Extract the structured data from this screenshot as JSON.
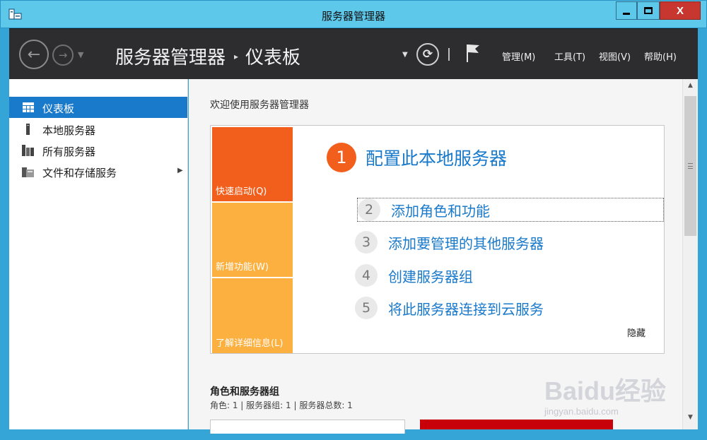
{
  "window": {
    "title": "服务器管理器",
    "min_icon": "minimize-icon",
    "max_icon": "maximize-icon",
    "close_label": "X"
  },
  "header": {
    "breadcrumb_root": "服务器管理器",
    "breadcrumb_separator": "▸",
    "breadcrumb_current": "仪表板",
    "menus": [
      "管理(M)",
      "工具(T)",
      "视图(V)",
      "帮助(H)"
    ]
  },
  "sidebar": {
    "items": [
      {
        "label": "仪表板",
        "icon": "dashboard-icon",
        "active": true
      },
      {
        "label": "本地服务器",
        "icon": "local-server-icon",
        "active": false
      },
      {
        "label": "所有服务器",
        "icon": "all-servers-icon",
        "active": false
      },
      {
        "label": "文件和存储服务",
        "icon": "file-storage-icon",
        "active": false,
        "has_arrow": true
      }
    ]
  },
  "main": {
    "welcome_title": "欢迎使用服务器管理器",
    "tiles": [
      "快速启动(Q)",
      "新增功能(W)",
      "了解详细信息(L)"
    ],
    "steps": [
      {
        "num": "1",
        "label": "配置此本地服务器"
      },
      {
        "num": "2",
        "label": "添加角色和功能"
      },
      {
        "num": "3",
        "label": "添加要管理的其他服务器"
      },
      {
        "num": "4",
        "label": "创建服务器组"
      },
      {
        "num": "5",
        "label": "将此服务器连接到云服务"
      }
    ],
    "hide_label": "隐藏",
    "roles_title": "角色和服务器组",
    "roles_summary": "角色: 1 | 服务器组: 1 | 服务器总数: 1"
  },
  "watermark": {
    "text": "Baidu经验",
    "url": "jingyan.baidu.com"
  },
  "colors": {
    "titlebar": "#5ec8eb",
    "header": "#2d2d30",
    "accent": "#1979ca",
    "tile_orange": "#f25f1c",
    "tile_yellow": "#fcb040",
    "close_red": "#c7372f"
  }
}
